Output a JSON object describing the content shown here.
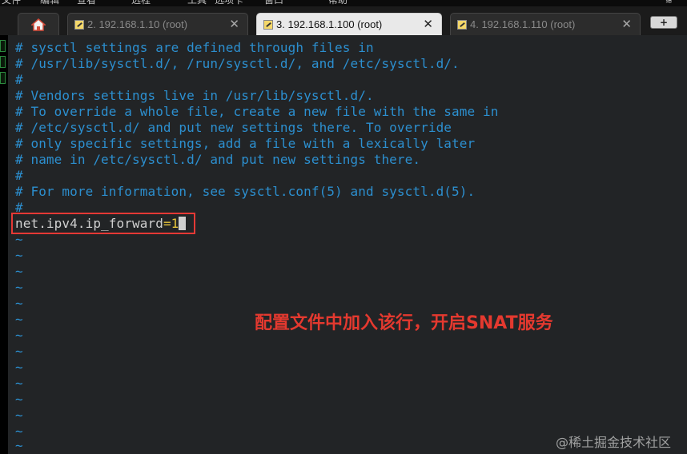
{
  "top_menu": {
    "items": [
      "文件",
      "编辑",
      "查看",
      "远程",
      "工具",
      "选项卡",
      "窗口",
      "帮助"
    ],
    "corner_text": "≋"
  },
  "tabs": [
    {
      "label": "2. 192.168.1.10 (root)",
      "active": false,
      "close": "✕"
    },
    {
      "label": "3. 192.168.1.100 (root)",
      "active": true,
      "close": "✕"
    },
    {
      "label": "4. 192.168.1.110 (root)",
      "active": false,
      "close": "✕"
    }
  ],
  "add_tab_label": "+",
  "terminal": {
    "comment_lines": [
      "# sysctl settings are defined through files in",
      "# /usr/lib/sysctl.d/, /run/sysctl.d/, and /etc/sysctl.d/.",
      "#",
      "# Vendors settings live in /usr/lib/sysctl.d/.",
      "# To override a whole file, create a new file with the same in",
      "# /etc/sysctl.d/ and put new settings there. To override",
      "# only specific settings, add a file with a lexically later",
      "# name in /etc/sysctl.d/ and put new settings there.",
      "#",
      "# For more information, see sysctl.conf(5) and sysctl.d(5).",
      "#"
    ],
    "config_line": {
      "key": "net.ipv4.ip_forward",
      "equals": "=",
      "value": "1"
    },
    "empty_marker": "~",
    "empty_line_count": 14
  },
  "annotation": "配置文件中加入该行，开启SNAT服务",
  "watermark": "@稀土掘金技术社区",
  "colors": {
    "comment": "#2c8fcf",
    "highlight_border": "#e53935",
    "annotation": "#e4392f",
    "active_tab": "#e9e9e9"
  }
}
